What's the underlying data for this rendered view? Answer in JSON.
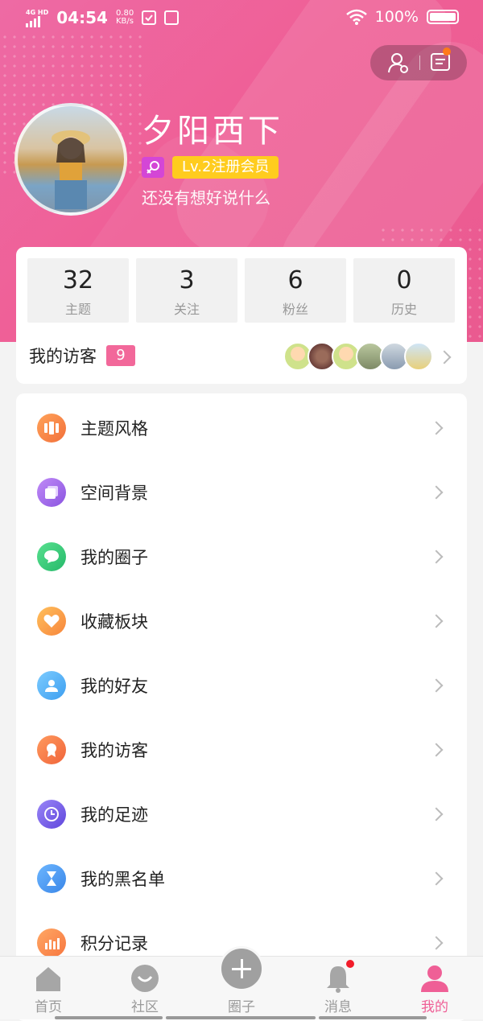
{
  "status_bar": {
    "network": "4G HD",
    "time": "04:54",
    "speed_value": "0.80",
    "speed_unit": "KB/s",
    "battery_pct": "100%"
  },
  "profile": {
    "name": "夕阳西下",
    "level": "Lv.2注册会员",
    "signature": "还没有想好说什么"
  },
  "stats": [
    {
      "value": "32",
      "label": "主题"
    },
    {
      "value": "3",
      "label": "关注"
    },
    {
      "value": "6",
      "label": "粉丝"
    },
    {
      "value": "0",
      "label": "历史"
    }
  ],
  "visitors": {
    "label": "我的访客",
    "count": "9"
  },
  "menu": [
    {
      "label": "主题风格",
      "icon": "theme-icon",
      "color": "#f7884a"
    },
    {
      "label": "空间背景",
      "icon": "background-icon",
      "color": "#a86ae8"
    },
    {
      "label": "我的圈子",
      "icon": "chat-bubble-icon",
      "color": "#3fcf7b"
    },
    {
      "label": "收藏板块",
      "icon": "heart-icon",
      "color": "#f9a14d"
    },
    {
      "label": "我的好友",
      "icon": "person-icon",
      "color": "#52b4f5"
    },
    {
      "label": "我的访客",
      "icon": "badge-icon",
      "color": "#f67b45"
    },
    {
      "label": "我的足迹",
      "icon": "clock-icon",
      "color": "#7a66e8"
    },
    {
      "label": "我的黑名单",
      "icon": "hourglass-icon",
      "color": "#4a9ef2"
    },
    {
      "label": "积分记录",
      "icon": "bar-chart-icon",
      "color": "#f98a45"
    }
  ],
  "tabs": [
    {
      "label": "首页",
      "icon": "home-icon"
    },
    {
      "label": "社区",
      "icon": "community-icon"
    },
    {
      "label": "圈子",
      "icon": "plus-icon"
    },
    {
      "label": "消息",
      "icon": "bell-icon"
    },
    {
      "label": "我的",
      "icon": "user-icon"
    }
  ],
  "colors": {
    "accent": "#ef5f96",
    "level_badge": "#ffcc1e",
    "visitor_badge": "#f2689a"
  }
}
